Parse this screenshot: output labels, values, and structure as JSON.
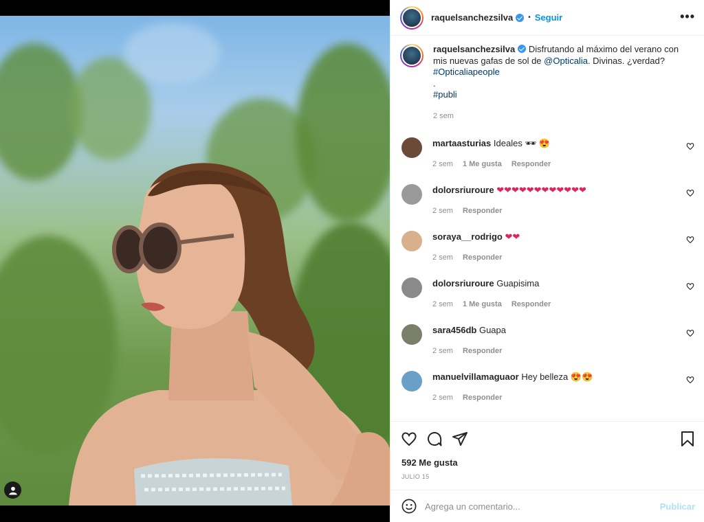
{
  "post": {
    "username": "raquelsanchezsilva",
    "follow_label": "Seguir",
    "more_label": "•••",
    "caption": {
      "username": "raquelsanchezsilva",
      "text_before": "Disfrutando al máximo del verano con mis nuevas gafas de sol de ",
      "mention": "@Opticalia",
      "text_after": ". Divinas. ¿verdad?",
      "hashtag1": "#Opticaliapeople",
      "dot": ".",
      "hashtag2": "#publi",
      "time": "2 sem"
    },
    "comments": [
      {
        "username": "martaasturias",
        "text": "Ideales 🕶 😍",
        "time": "2 sem",
        "likes": "1 Me gusta",
        "reply": "Responder",
        "avatar_color": "#6b4a3a"
      },
      {
        "username": "dolorsriuroure",
        "text": "❤❤❤❤❤❤❤❤❤❤❤❤",
        "time": "2 sem",
        "likes": "",
        "reply": "Responder",
        "avatar_color": "#9a9a9a"
      },
      {
        "username": "soraya__rodrigo",
        "text": "❤❤",
        "time": "2 sem",
        "likes": "",
        "reply": "Responder",
        "avatar_color": "#d9b08c"
      },
      {
        "username": "dolorsriuroure",
        "text": "Guapisima",
        "time": "2 sem",
        "likes": "1 Me gusta",
        "reply": "Responder",
        "avatar_color": "#8a8a8a"
      },
      {
        "username": "sara456db",
        "text": "Guapa",
        "time": "2 sem",
        "likes": "",
        "reply": "Responder",
        "avatar_color": "#7a7f6a"
      },
      {
        "username": "manuelvillamaguaor",
        "text": "Hey belleza 😍😍",
        "time": "2 sem",
        "likes": "",
        "reply": "Responder",
        "avatar_color": "#6aa0c8"
      }
    ],
    "likes_count": "592 Me gusta",
    "date": "JULIO 15",
    "comment_placeholder": "Agrega un comentario...",
    "publish_label": "Publicar"
  },
  "colors": {
    "accent": "#0095f6",
    "link": "#00376b",
    "muted": "#8e8e8e",
    "publish_disabled": "#b2dffc",
    "heart": "#e0245e"
  },
  "icons": [
    "verified-badge-icon",
    "more-options-icon",
    "heart-icon",
    "comment-icon",
    "share-icon",
    "bookmark-icon",
    "emoji-icon",
    "user-tag-icon"
  ]
}
